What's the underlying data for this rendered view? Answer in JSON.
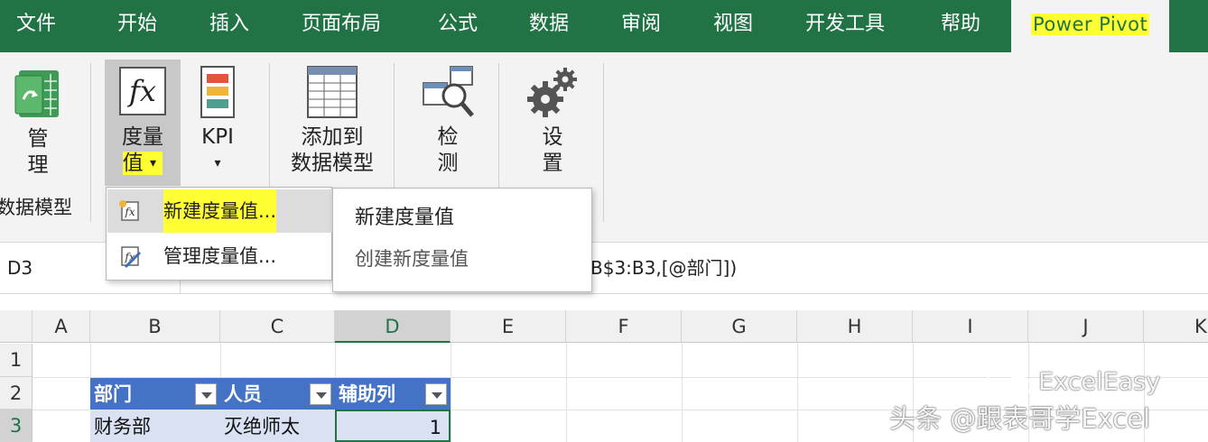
{
  "ribbon_tabs": [
    "文件",
    "开始",
    "插入",
    "页面布局",
    "公式",
    "数据",
    "审阅",
    "视图",
    "开发工具",
    "帮助",
    "Power Pivot"
  ],
  "ribbon": {
    "manage": {
      "line1": "管",
      "line2": "理"
    },
    "group_data_model": "数据模型",
    "measures": {
      "line1": "度量",
      "line2": "值",
      "caret": "▾"
    },
    "kpi": {
      "line1": "KPI",
      "caret": "▾"
    },
    "add_to_model": {
      "line1": "添加到",
      "line2": "数据模型"
    },
    "detect": {
      "line1": "检",
      "line2": "测"
    },
    "settings": {
      "line1": "设",
      "line2": "置"
    }
  },
  "dropdown": {
    "items": [
      {
        "label": "新建度量值..."
      },
      {
        "label": "管理度量值..."
      }
    ]
  },
  "tooltip": {
    "title": "新建度量值",
    "description": "创建新度量值"
  },
  "formula_bar": {
    "name_box": "D3",
    "formula_visible": "B$3:B3,[@部门])"
  },
  "grid": {
    "columns": [
      "A",
      "B",
      "C",
      "D",
      "E",
      "F",
      "G",
      "H",
      "I",
      "J",
      "K"
    ],
    "rows": [
      "1",
      "2",
      "3"
    ],
    "table": {
      "headers": [
        "部门",
        "人员",
        "辅助列"
      ],
      "row1": [
        "财务部",
        "灭绝师太",
        "1"
      ]
    }
  },
  "watermark": {
    "brand": "ExcelEasy",
    "line": "头条 @跟表哥学Excel"
  },
  "colors": {
    "excel_green": "#217346",
    "highlight_yellow": "#ffff33",
    "table_header_blue": "#4472c4",
    "table_row_blue": "#d9e1f2"
  }
}
